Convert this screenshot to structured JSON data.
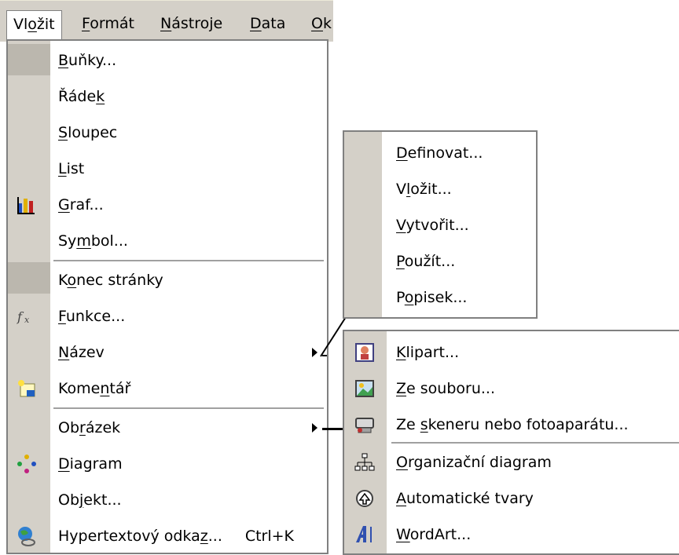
{
  "menubar": {
    "items": [
      {
        "label": "Vložit",
        "u": "o",
        "pre": "Vl",
        "post": "žit"
      },
      {
        "label": "Formát",
        "pre": "",
        "u": "F",
        "post": "ormát"
      },
      {
        "label": "Nástroje",
        "pre": "",
        "u": "N",
        "post": "ástroje"
      },
      {
        "label": "Data",
        "pre": "",
        "u": "D",
        "post": "ata"
      },
      {
        "label": "Ok",
        "pre": "",
        "u": "O",
        "post": "k"
      }
    ]
  },
  "main_menu": {
    "items": [
      {
        "pre": "",
        "u": "B",
        "post": "uňky..."
      },
      {
        "pre": "Řáde",
        "u": "k",
        "post": ""
      },
      {
        "pre": "",
        "u": "S",
        "post": "loupec"
      },
      {
        "pre": "",
        "u": "L",
        "post": "ist"
      },
      {
        "pre": "",
        "u": "G",
        "post": "raf...",
        "icon": "chart-icon"
      },
      {
        "pre": "Sy",
        "u": "m",
        "post": "bol..."
      },
      {
        "pre": "K",
        "u": "o",
        "post": "nec stránky"
      },
      {
        "pre": "",
        "u": "F",
        "post": "unkce...",
        "icon": "function-icon"
      },
      {
        "pre": "",
        "u": "N",
        "post": "ázev",
        "arrow": true
      },
      {
        "pre": "Kome",
        "u": "n",
        "post": "tář",
        "icon": "comment-icon"
      },
      {
        "pre": "Ob",
        "u": "r",
        "post": "ázek",
        "arrow": true
      },
      {
        "pre": "",
        "u": "D",
        "post": "iagram",
        "icon": "diagram-icon"
      },
      {
        "pre": "Ob",
        "u": "j",
        "post": "ekt..."
      },
      {
        "pre": "Hypertextový odka",
        "u": "z",
        "post": "...",
        "shortcut": "Ctrl+K",
        "icon": "hyperlink-icon"
      }
    ]
  },
  "submenu_nazev": {
    "items": [
      {
        "pre": "",
        "u": "D",
        "post": "efinovat..."
      },
      {
        "pre": "V",
        "u": "l",
        "post": "ožit..."
      },
      {
        "pre": "",
        "u": "V",
        "post": "ytvořit..."
      },
      {
        "pre": "",
        "u": "P",
        "post": "oužít..."
      },
      {
        "pre": "P",
        "u": "o",
        "post": "pisek..."
      }
    ]
  },
  "submenu_obrazek": {
    "items": [
      {
        "pre": "",
        "u": "K",
        "post": "lipart...",
        "icon": "clipart-icon"
      },
      {
        "pre": "",
        "u": "Z",
        "post": "e souboru...",
        "icon": "picture-file-icon"
      },
      {
        "pre": "Ze ",
        "u": "s",
        "post": "keneru nebo fotoaparátu...",
        "icon": "scanner-icon"
      },
      {
        "pre": "",
        "u": "O",
        "post": "rganizační diagram",
        "icon": "org-chart-icon"
      },
      {
        "pre": "",
        "u": "A",
        "post": "utomatické tvary",
        "icon": "autoshapes-icon"
      },
      {
        "pre": "",
        "u": "W",
        "post": "ordArt...",
        "icon": "wordart-icon"
      }
    ]
  }
}
